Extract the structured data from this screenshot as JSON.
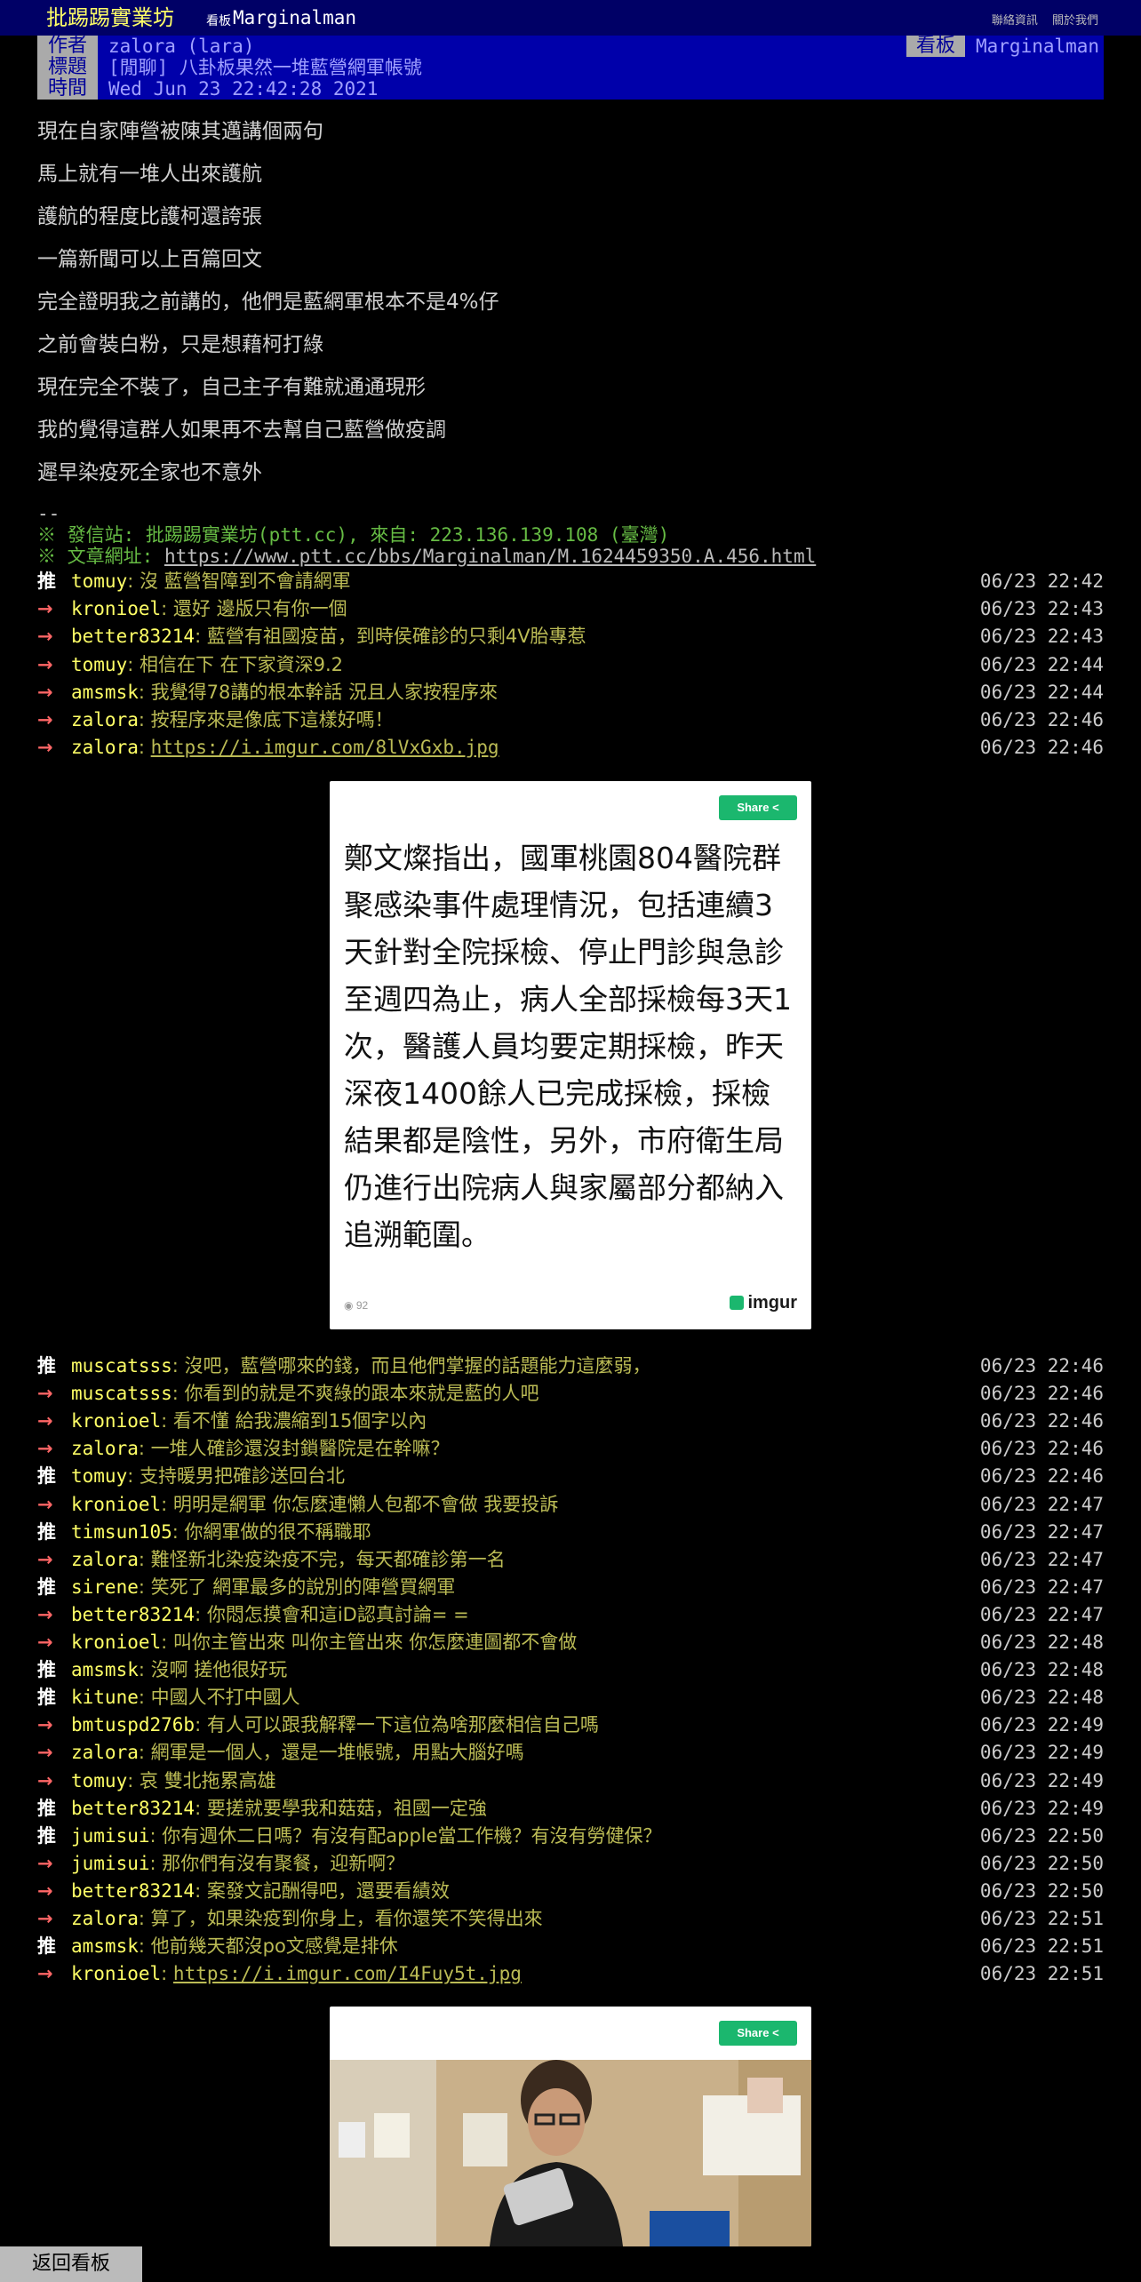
{
  "site": {
    "title": "批踢踢實業坊",
    "board_tag": "看板",
    "board_name": "Marginalman",
    "link_contact": "聯絡資訊",
    "link_about": "關於我們"
  },
  "meta": {
    "author_label": "作者",
    "author": "zalora (lara)",
    "board_label": "看板",
    "board": "Marginalman",
    "title_label": "標題",
    "title": "[閒聊] 八卦板果然一堆藍營網軍帳號",
    "time_label": "時間",
    "time": "Wed Jun 23 22:42:28 2021"
  },
  "content": [
    "現在自家陣營被陳其邁講個兩句",
    "馬上就有一堆人出來護航",
    "護航的程度比護柯還誇張",
    "一篇新聞可以上百篇回文",
    "完全證明我之前講的，他們是藍網軍根本不是4%仔",
    "之前會裝白粉，只是想藉柯打綠",
    "現在完全不裝了，自己主子有難就通通現形",
    "我的覺得這群人如果再不去幫自己藍營做疫調",
    "遲早染疫死全家也不意外"
  ],
  "signature": {
    "dash": "--",
    "post_from": "※ 發信站: 批踢踢實業坊(ptt.cc), 來自: 223.136.139.108 (臺灣)",
    "url_label": "※ 文章網址: ",
    "url": "https://www.ptt.cc/bbs/Marginalman/M.1624459350.A.456.html"
  },
  "pushes_a": [
    {
      "tag": "推",
      "user": "tomuy",
      "content": ": 沒  藍營智障到不會請網軍",
      "time": "06/23 22:42"
    },
    {
      "tag": "→",
      "user": "kronioel",
      "content": ": 還好  邊版只有你一個",
      "time": "06/23 22:43"
    },
    {
      "tag": "→",
      "user": "better83214",
      "content": ": 藍營有祖國疫苗，到時侯確診的只剩4V胎專惹",
      "time": "06/23 22:43"
    },
    {
      "tag": "→",
      "user": "tomuy",
      "content": ": 相信在下  在下家資深9.2",
      "time": "06/23 22:44"
    },
    {
      "tag": "→",
      "user": "amsmsk",
      "content": ": 我覺得78講的根本幹話   況且人家按程序來",
      "time": "06/23 22:44"
    },
    {
      "tag": "→",
      "user": "zalora",
      "content": ": 按程序來是像底下這樣好嗎！",
      "time": "06/23 22:46"
    },
    {
      "tag": "→",
      "user": "zalora",
      "content": ": ",
      "link": "https://i.imgur.com/8lVxGxb.jpg",
      "time": "06/23 22:46"
    }
  ],
  "card1": {
    "share_label": "Share",
    "text": "鄭文燦指出，國軍桃園804醫院群聚感染事件處理情況，包括連續3天針對全院採檢、停止門診與急診至週四為止，病人全部採檢每3天1次，醫護人員均要定期採檢，昨天深夜1400餘人已完成採檢，採檢結果都是陰性，另外，市府衛生局仍進行出院病人與家屬部分都納入追溯範圍。",
    "views": "92",
    "brand": "imgur"
  },
  "pushes_b": [
    {
      "tag": "推",
      "user": "muscatsss",
      "content": ": 沒吧，藍營哪來的錢，而且他們掌握的話題能力這麼弱，",
      "time": "06/23 22:46"
    },
    {
      "tag": "→",
      "user": "muscatsss",
      "content": ": 你看到的就是不爽綠的跟本來就是藍的人吧",
      "time": "06/23 22:46"
    },
    {
      "tag": "→",
      "user": "kronioel",
      "content": ": 看不懂   給我濃縮到15個字以內",
      "time": "06/23 22:46"
    },
    {
      "tag": "→",
      "user": "zalora",
      "content": ": 一堆人確診還沒封鎖醫院是在幹嘛？",
      "time": "06/23 22:46"
    },
    {
      "tag": "推",
      "user": "tomuy",
      "content": ": 支持暖男把確診送回台北",
      "time": "06/23 22:46"
    },
    {
      "tag": "→",
      "user": "kronioel",
      "content": ": 明明是網軍  你怎麼連懶人包都不會做  我要投訴",
      "time": "06/23 22:47"
    },
    {
      "tag": "推",
      "user": "timsun105",
      "content": ": 你網軍做的很不稱職耶",
      "time": "06/23 22:47"
    },
    {
      "tag": "→",
      "user": "zalora",
      "content": ": 難怪新北染疫染疫不完，每天都確診第一名",
      "time": "06/23 22:47"
    },
    {
      "tag": "推",
      "user": "sirene",
      "content": ": 笑死了  網軍最多的說別的陣營買網軍",
      "time": "06/23 22:47"
    },
    {
      "tag": "→",
      "user": "better83214",
      "content": ": 你悶怎摸會和這iD認真討論= =",
      "time": "06/23 22:47"
    },
    {
      "tag": "→",
      "user": "kronioel",
      "content": ": 叫你主管出來  叫你主管出來  你怎麼連圖都不會做",
      "time": "06/23 22:48"
    },
    {
      "tag": "推",
      "user": "amsmsk",
      "content": ": 沒啊    搓他很好玩",
      "time": "06/23 22:48"
    },
    {
      "tag": "推",
      "user": "kitune",
      "content": ": 中國人不打中國人",
      "time": "06/23 22:48"
    },
    {
      "tag": "→",
      "user": "bmtuspd276b",
      "content": ": 有人可以跟我解釋一下這位為啥那麼相信自己嗎",
      "time": "06/23 22:49"
    },
    {
      "tag": "→",
      "user": "zalora",
      "content": ": 網軍是一個人，還是一堆帳號，用點大腦好嗎",
      "time": "06/23 22:49"
    },
    {
      "tag": "→",
      "user": "tomuy",
      "content": ": 哀  雙北拖累高雄",
      "time": "06/23 22:49"
    },
    {
      "tag": "推",
      "user": "better83214",
      "content": ": 要搓就要學我和菇菇，祖國一定強",
      "time": "06/23 22:49"
    },
    {
      "tag": "推",
      "user": "jumisui",
      "content": ": 你有週休二日嗎？有沒有配apple當工作機？有沒有勞健保？",
      "time": "06/23 22:50"
    },
    {
      "tag": "→",
      "user": "jumisui",
      "content": ": 那你們有沒有聚餐，迎新啊？",
      "time": "06/23 22:50"
    },
    {
      "tag": "→",
      "user": "better83214",
      "content": ": 案發文記酬得吧，還要看績效",
      "time": "06/23 22:50"
    },
    {
      "tag": "→",
      "user": "zalora",
      "content": ": 算了，如果染疫到你身上，看你還笑不笑得出來",
      "time": "06/23 22:51"
    },
    {
      "tag": "推",
      "user": "amsmsk",
      "content": ": 他前幾天都沒po文感覺是排休",
      "time": "06/23 22:51"
    },
    {
      "tag": "→",
      "user": "kronioel",
      "content": ": ",
      "link": "https://i.imgur.com/I4Fuy5t.jpg",
      "time": "06/23 22:51"
    }
  ],
  "card2": {
    "share_label": "Share"
  },
  "bottom": {
    "back_label": "返回看板"
  },
  "colors": {
    "background": "#000000",
    "topbar": "#000066",
    "meta_bg": "#0000aa",
    "site_title": "#ffff66",
    "push_user": "#ffff66",
    "push_content": "#bbbb55",
    "push_arrow": "#ff6666",
    "share_button": "#1bb76e"
  }
}
